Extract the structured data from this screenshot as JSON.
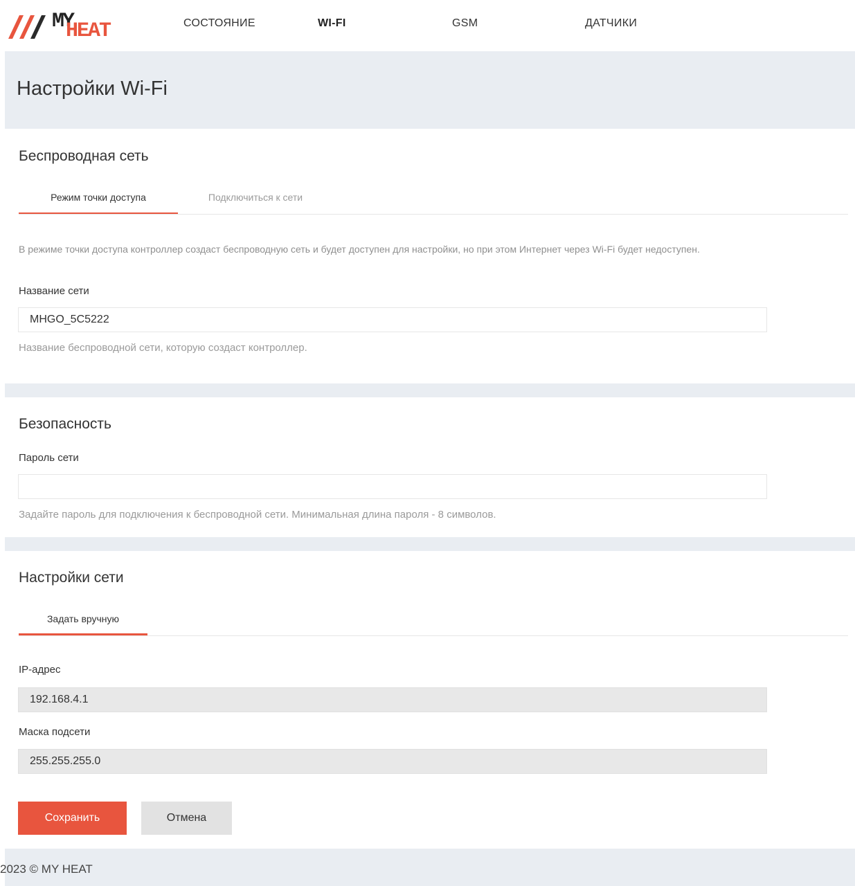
{
  "brand": {
    "logo_my": "MY",
    "logo_heat": "HEAT",
    "accent_color": "#e8553e"
  },
  "nav": {
    "items": [
      {
        "label": "СОСТОЯНИЕ"
      },
      {
        "label": "WI-FI"
      },
      {
        "label": "GSM"
      },
      {
        "label": "ДАТЧИКИ"
      }
    ],
    "active": "WI-FI"
  },
  "page": {
    "title": "Настройки Wi-Fi"
  },
  "wireless": {
    "title": "Беспроводная сеть",
    "tabs": [
      {
        "label": "Режим точки доступа"
      },
      {
        "label": "Подключиться к сети"
      }
    ],
    "description": "В режиме точки доступа контроллер создаст беспроводную сеть и будет доступен для настройки, но при этом Интернет через Wi-Fi будет недоступен.",
    "ssid_label": "Название сети",
    "ssid_value": "MHGO_5C5222",
    "ssid_hint": "Название беспроводной сети, которую создаст контроллер."
  },
  "security": {
    "title": "Безопасность",
    "password_label": "Пароль сети",
    "password_value": "",
    "password_hint": "Задайте пароль для подключения к беспроводной сети. Минимальная длина пароля - 8 символов."
  },
  "network": {
    "title": "Настройки сети",
    "tabs": [
      {
        "label": "Задать вручную"
      }
    ],
    "ip_label": "IP-адрес",
    "ip_value": "192.168.4.1",
    "mask_label": "Маска подсети",
    "mask_value": "255.255.255.0"
  },
  "actions": {
    "save_label": "Сохранить",
    "cancel_label": "Отмена"
  },
  "footer": {
    "text": "2023 © MY HEAT"
  }
}
